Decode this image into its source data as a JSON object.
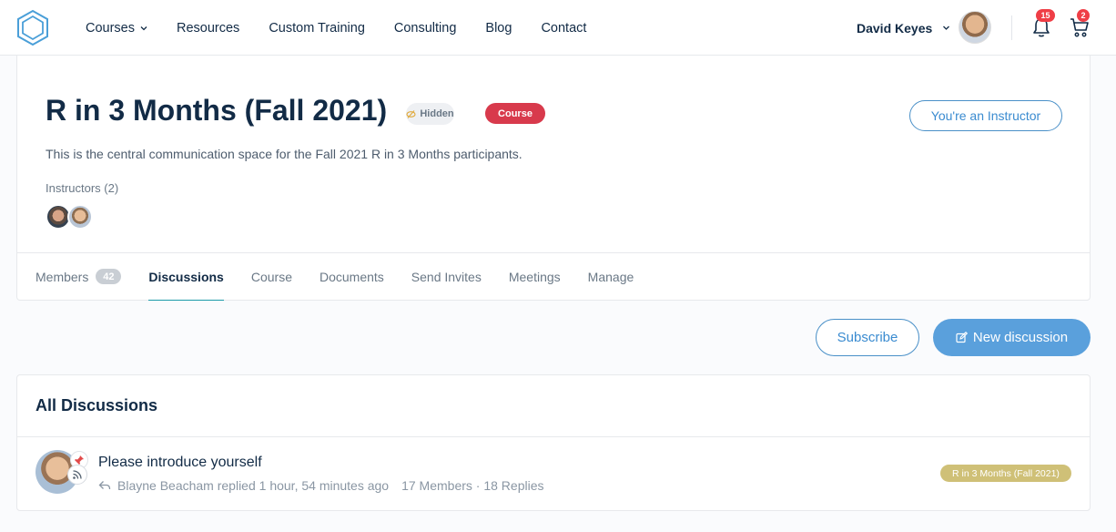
{
  "header": {
    "logo_icon": "hexagon-logo-icon",
    "nav": [
      {
        "label": "Courses",
        "has_dropdown": true
      },
      {
        "label": "Resources"
      },
      {
        "label": "Custom Training"
      },
      {
        "label": "Consulting"
      },
      {
        "label": "Blog"
      },
      {
        "label": "Contact"
      }
    ],
    "user_name": "David Keyes",
    "notifications_count": "15",
    "cart_count": "2"
  },
  "group": {
    "title": "R in 3 Months (Fall 2021)",
    "badge_hidden": "Hidden",
    "badge_type": "Course",
    "instructor_button": "You're an Instructor",
    "description": "This is the central communication space for the Fall 2021 R in 3 Months participants.",
    "instructors_label": "Instructors (2)",
    "tabs": [
      {
        "label": "Members",
        "count": "42"
      },
      {
        "label": "Discussions",
        "active": true
      },
      {
        "label": "Course"
      },
      {
        "label": "Documents"
      },
      {
        "label": "Send Invites"
      },
      {
        "label": "Meetings"
      },
      {
        "label": "Manage"
      }
    ]
  },
  "actions": {
    "subscribe": "Subscribe",
    "new_discussion": "New discussion"
  },
  "discussions": {
    "heading": "All Discussions",
    "items": [
      {
        "title": "Please introduce yourself",
        "last_reply": "Blayne Beacham replied 1 hour, 54 minutes ago",
        "counts": "17 Members · 18 Replies",
        "tag": "R in 3 Months (Fall 2021)"
      }
    ]
  },
  "colors": {
    "accent": "#3a8bd0",
    "primary_button": "#5aa0dc",
    "course_badge": "#d83a4c",
    "notification_badge": "#ef3e46",
    "group_tag": "#cfc077"
  }
}
